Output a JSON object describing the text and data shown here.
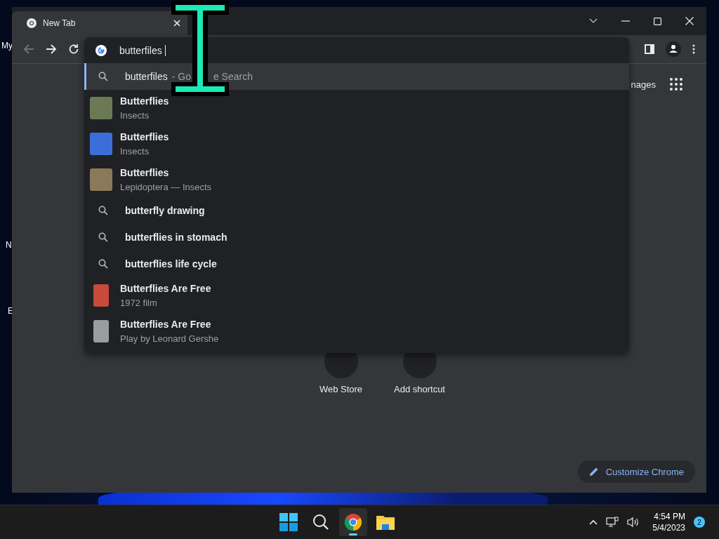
{
  "desktop": {
    "icon_labels": [
      "My",
      "N",
      "E"
    ]
  },
  "window": {
    "tabs": [
      {
        "title": "New Tab",
        "selected": true
      }
    ]
  },
  "omnibox": {
    "value": "butterfiles"
  },
  "suggestions": [
    {
      "kind": "search",
      "text": "butterfiles",
      "suffix_parts": [
        "- Go",
        "e Search"
      ],
      "selected": true
    },
    {
      "kind": "entity",
      "title": "Butterflies",
      "subtitle": "Insects",
      "selected": false
    },
    {
      "kind": "entity",
      "title": "Butterflies",
      "subtitle": "Insects",
      "selected": false
    },
    {
      "kind": "entity",
      "title": "Butterflies",
      "subtitle": "Lepidoptera — Insects",
      "selected": false
    },
    {
      "kind": "search",
      "text": "butterfly drawing",
      "selected": false
    },
    {
      "kind": "search",
      "text": "butterflies in stomach",
      "selected": false
    },
    {
      "kind": "search",
      "text": "butterflies life cycle",
      "selected": false
    },
    {
      "kind": "entity",
      "title": "Butterflies Are Free",
      "subtitle": "1972 film",
      "selected": false
    },
    {
      "kind": "entity",
      "title": "Butterflies Are Free",
      "subtitle": "Play by Leonard Gershe",
      "selected": false
    }
  ],
  "page": {
    "top_link": "nages",
    "shortcuts": [
      "Web Store",
      "Add shortcut"
    ],
    "customize_button": "Customize Chrome"
  },
  "taskbar": {
    "apps": [
      {
        "kind": "start",
        "active": false
      },
      {
        "kind": "search",
        "active": false
      },
      {
        "kind": "chrome",
        "active": true
      },
      {
        "kind": "files",
        "active": false
      }
    ],
    "time": "4:54 PM",
    "date": "5/4/2023",
    "notification_count": "2"
  }
}
